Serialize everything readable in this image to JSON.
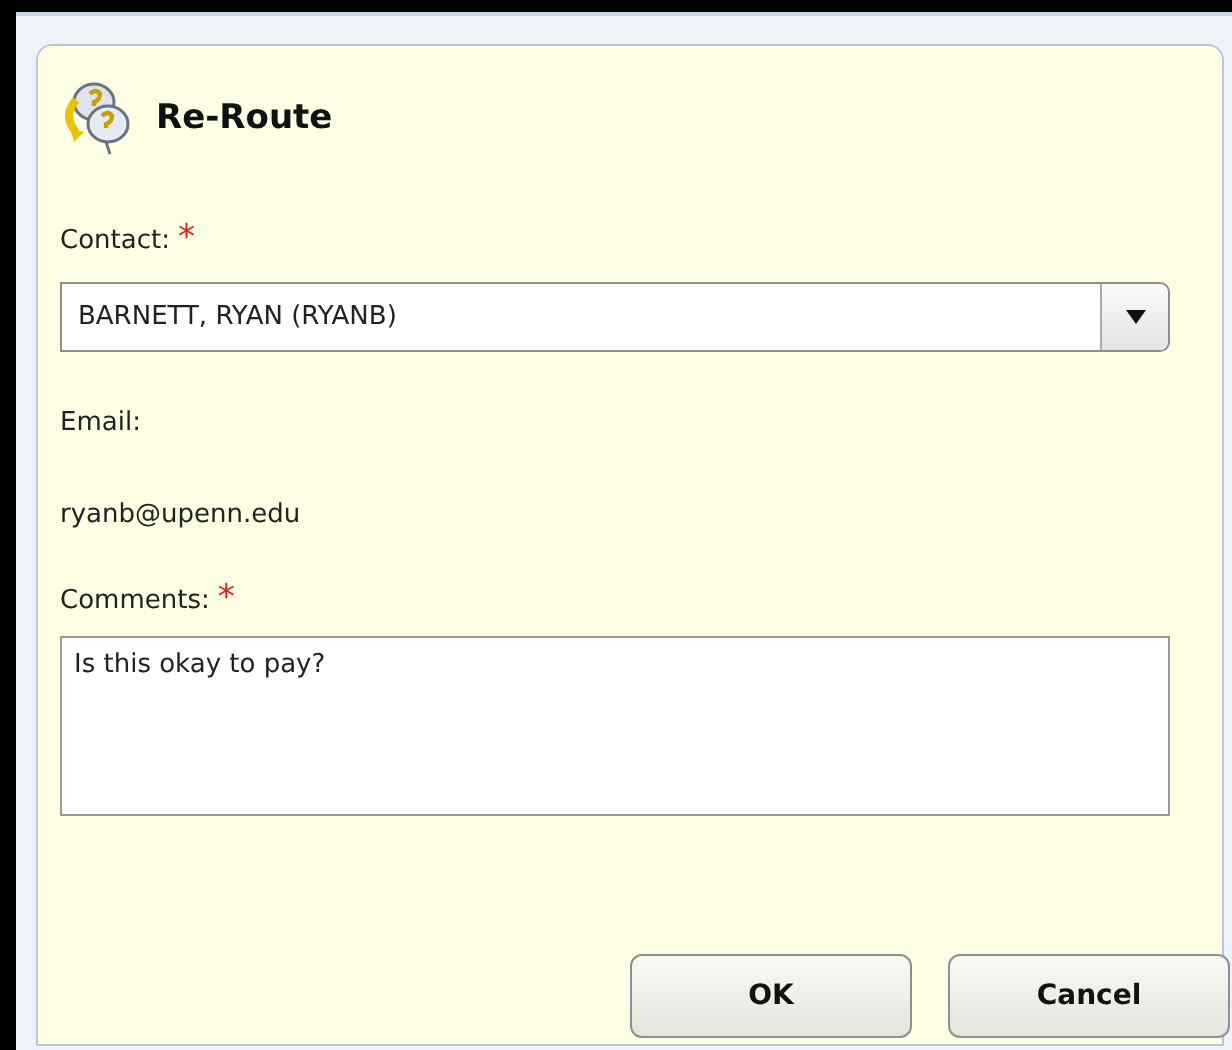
{
  "dialog": {
    "title": "Re-Route"
  },
  "fields": [
    {
      "kind": "combo",
      "label": "Contact:",
      "required_mark": "*",
      "value": "BARNETT, RYAN (RYANB)"
    },
    {
      "kind": "static",
      "label": "Email:",
      "value": "ryanb@upenn.edu"
    },
    {
      "kind": "textarea",
      "label": "Comments:",
      "required_mark": "*",
      "value": "Is this okay to pay?"
    }
  ],
  "buttons": [
    {
      "label": "OK"
    },
    {
      "label": "Cancel"
    }
  ]
}
